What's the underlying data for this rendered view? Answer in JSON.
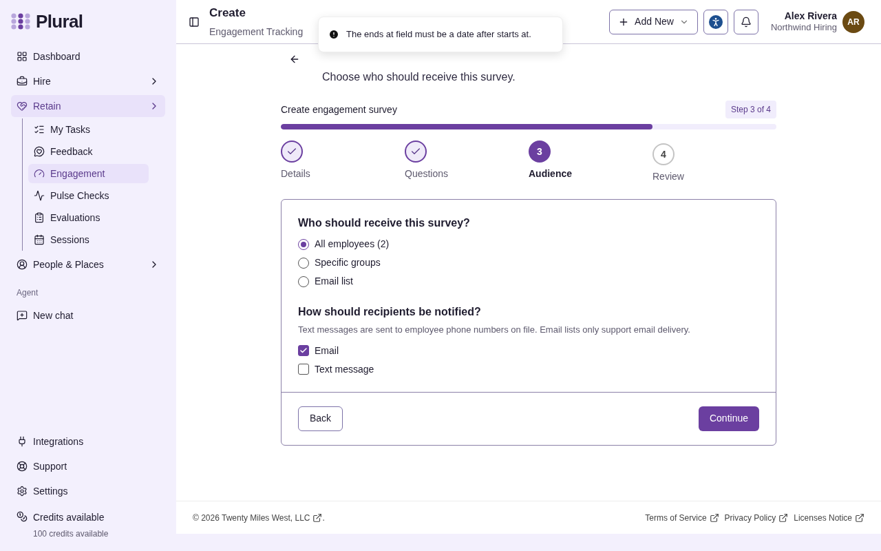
{
  "brand": {
    "name": "Plural"
  },
  "nav": [
    {
      "label": "Dashboard",
      "selected": false,
      "has_children": false
    },
    {
      "label": "Hire",
      "selected": false,
      "has_children": true
    },
    {
      "label": "Retain",
      "selected": true,
      "has_children": true,
      "children": [
        {
          "label": "My Tasks",
          "selected": false
        },
        {
          "label": "Feedback",
          "selected": false
        },
        {
          "label": "Engagement",
          "selected": true
        },
        {
          "label": "Pulse Checks",
          "selected": false
        },
        {
          "label": "Evaluations",
          "selected": false
        },
        {
          "label": "Sessions",
          "selected": false
        }
      ]
    },
    {
      "label": "People & Places",
      "selected": false,
      "has_children": true
    }
  ],
  "agent": {
    "heading": "Agent",
    "items": [
      {
        "label": "New chat"
      }
    ]
  },
  "bottom_nav": [
    {
      "label": "Integrations"
    },
    {
      "label": "Support"
    },
    {
      "label": "Settings"
    }
  ],
  "credits": {
    "label": "Credits available",
    "detail": "100 credits available"
  },
  "header": {
    "title": "Create",
    "subtitle": "Engagement Tracking",
    "add_button": "Add New",
    "user_name": "Alex Rivera",
    "user_org": "Northwind Hiring",
    "avatar": "AR"
  },
  "toast": {
    "message": "The ends at field must be a date after starts at."
  },
  "page": {
    "description": "Choose who should receive this survey."
  },
  "wizard": {
    "title": "Create engagement survey",
    "step_badge": "Step 3 of 4",
    "level": 0.75,
    "steps": [
      {
        "kind": "done",
        "label": "Details"
      },
      {
        "kind": "done",
        "label": "Questions"
      },
      {
        "kind": "current",
        "number": "3",
        "label": "Audience"
      },
      {
        "kind": "upcoming",
        "number": "4",
        "label": "Review"
      }
    ]
  },
  "audience": {
    "question": "Who should receive this survey?",
    "options": [
      {
        "label": "All employees (2)",
        "selected": true
      },
      {
        "label": "Specific groups",
        "selected": false
      },
      {
        "label": "Email list",
        "selected": false
      }
    ]
  },
  "notify": {
    "question": "How should recipients be notified?",
    "hint": "Text messages are sent to employee phone numbers on file. Email lists only support email delivery.",
    "options": [
      {
        "label": "Email",
        "checked": true
      },
      {
        "label": "Text message",
        "checked": false
      }
    ]
  },
  "actions": {
    "back": "Back",
    "continue": "Continue"
  },
  "footer": {
    "copyright": "© 2026 Twenty Miles West, LLC",
    "period": ".",
    "links": [
      "Terms of Service",
      "Privacy Policy",
      "Licenses Notice"
    ]
  }
}
